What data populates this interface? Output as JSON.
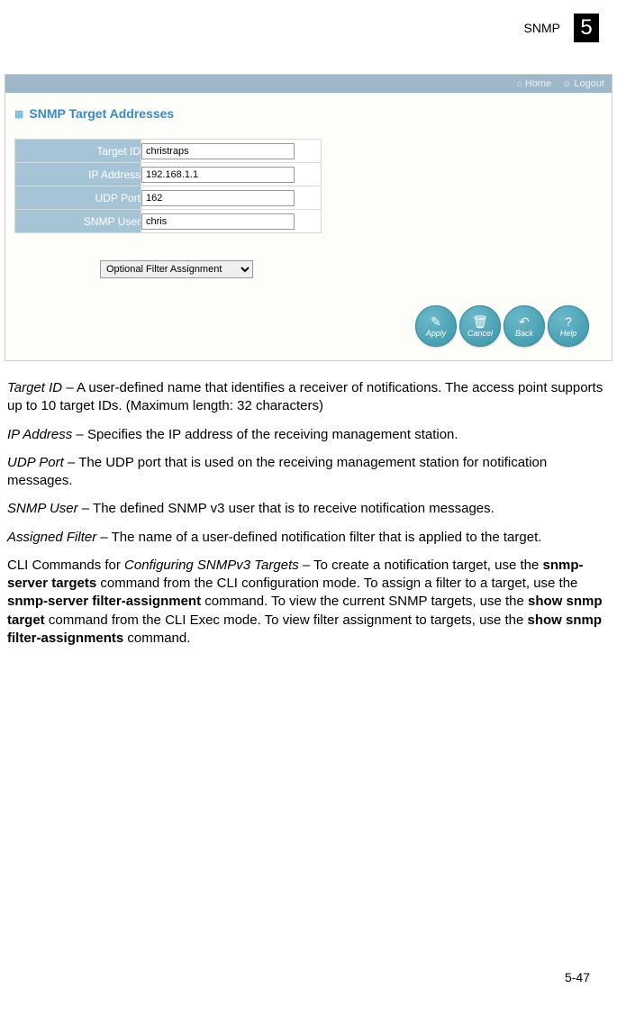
{
  "header": {
    "section_label": "SNMP",
    "chapter_number": "5"
  },
  "screenshot": {
    "topbar": {
      "home_label": "Home",
      "logout_label": "Logout"
    },
    "panel_title": "SNMP Target Addresses",
    "form": {
      "target_id": {
        "label": "Target ID",
        "value": "christraps"
      },
      "ip_address": {
        "label": "IP Address",
        "value": "192.168.1.1"
      },
      "udp_port": {
        "label": "UDP Port",
        "value": "162"
      },
      "snmp_user": {
        "label": "SNMP User",
        "value": "chris"
      },
      "filter_select": {
        "label": "Optional Filter Assignment"
      }
    },
    "buttons": {
      "apply": "Apply",
      "cancel": "Cancel",
      "back": "Back",
      "help": "Help"
    }
  },
  "text": {
    "p1_label": "Target ID",
    "p1_rest": " – A user-defined name that identifies a receiver of notifications. The access point supports up to 10 target IDs. (Maximum length: 32 characters)",
    "p2_label": "IP Address",
    "p2_rest": " – Specifies the IP address of the receiving management station.",
    "p3_label": "UDP Port",
    "p3_rest": " – The UDP port that is used on the receiving management station for notification messages.",
    "p4_label": "SNMP User",
    "p4_rest": " – The defined SNMP v3 user that is to receive notification messages.",
    "p5_label": "Assigned Filter",
    "p5_rest": " – The name of a user-defined notification filter that is applied to the target.",
    "p6_pre": "CLI Commands for ",
    "p6_italic": "Configuring SNMPv3 Targets",
    "p6_mid1": " – To create a notification target, use the ",
    "p6_bold1": "snmp-server targets",
    "p6_mid2": " command from the CLI configuration mode. To assign a filter to a target, use the ",
    "p6_bold2": "snmp-server filter-assignment",
    "p6_mid3": " command. To view the current SNMP targets, use the ",
    "p6_bold3": "show snmp target",
    "p6_mid4": " command from the CLI Exec mode. To view filter assignment to targets, use the ",
    "p6_bold4": "show snmp filter-assignments",
    "p6_end": " command."
  },
  "page_number": "5-47"
}
